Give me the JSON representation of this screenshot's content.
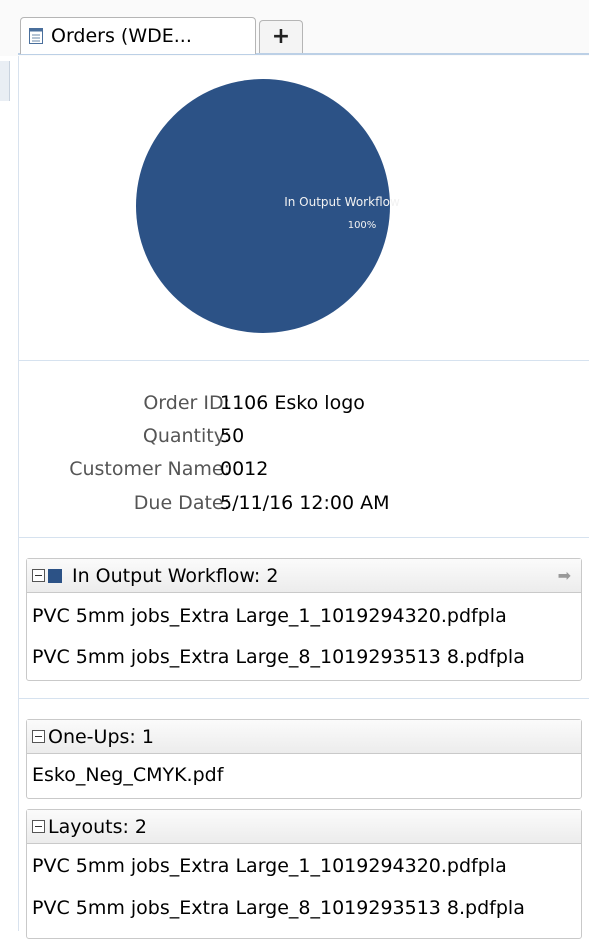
{
  "tab": {
    "label": "Orders (WDE...",
    "add_label": "+"
  },
  "chart_data": {
    "type": "pie",
    "slices": [
      {
        "label": "In Output Workflow",
        "value": 100,
        "percent_label": "100%",
        "color": "#2c5286"
      }
    ]
  },
  "details": {
    "order_id_label": "Order ID:",
    "order_id": "1106 Esko logo",
    "quantity_label": "Quantity:",
    "quantity": "50",
    "customer_label": "Customer Name:",
    "customer": "0012",
    "due_label": "Due Date:",
    "due": "5/11/16 12:00 AM"
  },
  "workflow_group": {
    "title": "In Output Workflow: 2",
    "swatch_color": "#2c5286",
    "items": [
      "PVC 5mm jobs_Extra Large_1_1019294320.pdfpla",
      "PVC 5mm jobs_Extra Large_8_1019293513 8.pdfpla"
    ]
  },
  "oneups_group": {
    "title": "One-Ups: 1",
    "items": [
      "Esko_Neg_CMYK.pdf"
    ]
  },
  "layouts_group": {
    "title": "Layouts: 2",
    "items": [
      "PVC 5mm jobs_Extra Large_1_1019294320.pdfpla",
      "PVC 5mm jobs_Extra Large_8_1019293513 8.pdfpla"
    ]
  }
}
